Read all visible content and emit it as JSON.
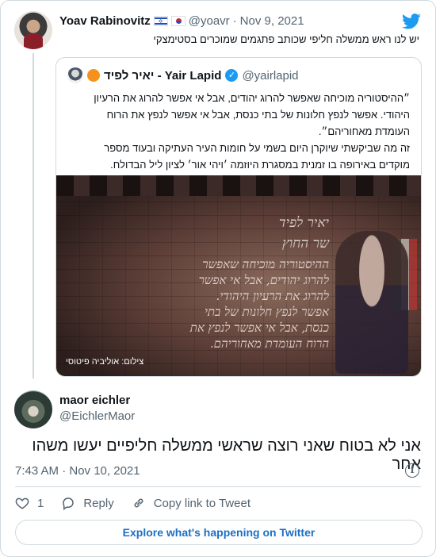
{
  "parent_tweet": {
    "author_name": "Yoav Rabinovitz",
    "handle": "@yoavr",
    "date": "Nov 9, 2021",
    "separator": "·",
    "flags": [
      "israel-flag",
      "south-korea-flag"
    ],
    "text": "יש לנו ראש ממשלה חליפי שכותב פתגמים שמוכרים בסטימצקי"
  },
  "quoted_tweet": {
    "author_name": "יאיר לפיד - Yair Lapid",
    "handle": "@yairlapid",
    "text_lines": [
      "״ההיסטוריה מוכיחה שאפשר להרוג יהודים, אבל אי אפשר להרוג את הרעיון",
      "היהודי. אפשר לנפץ חלונות של בתי כנסת, אבל אי אפשר לנפץ את הרוח",
      "העומדת מאחוריהם״.",
      "זה מה שביקשתי שיוקרן היום בשמי על חומות העיר העתיקה ובעוד מספר",
      "מוקדים באירופה בו זמנית במסגרת היוזמה ׳ויהי אור׳ לציון ליל הבדולח."
    ],
    "media": {
      "projection_lines": [
        "יאיר לפיד",
        "שר החוץ",
        "ההיסטוריה מוכיחה שאפשר",
        "להרוג יהודים, אבל אי אפשר",
        "להרוג את הרעיון היהודי.",
        "אפשר לנפץ חלונות של בתי",
        "כנסת, אבל אי אפשר לנפץ את",
        "הרוח העומדת מאחוריהם."
      ],
      "caption": "צילום: אוליביה פיטוסי"
    }
  },
  "reply": {
    "author_name": "maor eichler",
    "handle": "@EichlerMaor",
    "text": "אני לא בטוח שאני רוצה שראשי ממשלה חליפיים יעשו משהו אחר",
    "timestamp": "7:43 AM · Nov 10, 2021"
  },
  "actions": {
    "like_count": "1",
    "reply_label": "Reply",
    "copy_label": "Copy link to Tweet"
  },
  "explore_label": "Explore what's happening on Twitter",
  "colors": {
    "accent": "#1d9bf0",
    "link": "#1d6fc4",
    "muted": "#536471",
    "border": "#cfd9de"
  }
}
